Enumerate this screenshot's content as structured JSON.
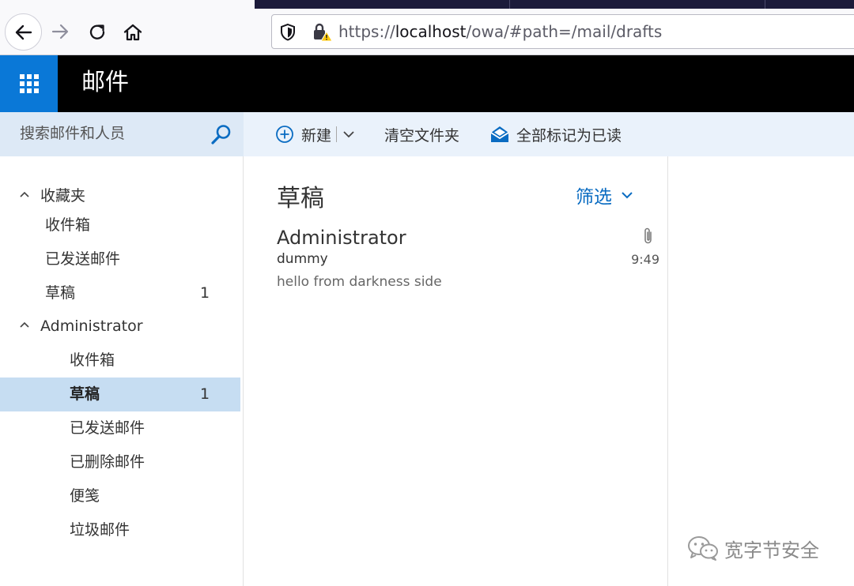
{
  "browser": {
    "url_prefix": "https://",
    "url_host": "localhost",
    "url_path": "/owa/#path=/mail/drafts"
  },
  "header": {
    "app_title": "邮件"
  },
  "search": {
    "placeholder": "搜索邮件和人员"
  },
  "toolbar": {
    "new_label": "新建",
    "empty_folder_label": "清空文件夹",
    "mark_all_read_label": "全部标记为已读"
  },
  "folders": {
    "favorites_header": "收藏夹",
    "favorites": [
      {
        "label": "收件箱",
        "count": ""
      },
      {
        "label": "已发送邮件",
        "count": ""
      },
      {
        "label": "草稿",
        "count": "1"
      }
    ],
    "account_header": "Administrator",
    "account": [
      {
        "label": "收件箱",
        "count": ""
      },
      {
        "label": "草稿",
        "count": "1",
        "selected": true
      },
      {
        "label": "已发送邮件",
        "count": ""
      },
      {
        "label": "已删除邮件",
        "count": ""
      },
      {
        "label": "便笺",
        "count": ""
      },
      {
        "label": "垃圾邮件",
        "count": ""
      }
    ]
  },
  "message_list": {
    "title": "草稿",
    "filter_label": "筛选",
    "items": [
      {
        "sender": "Administrator",
        "subject": "dummy",
        "time": "9:49",
        "preview": "hello from darkness side",
        "has_attachment": true
      }
    ]
  },
  "watermark": {
    "text": "宽字节安全"
  },
  "colors": {
    "accent": "#0a78d7",
    "header_bg": "#000000",
    "selected_folder_bg": "#c6ddf2",
    "toolbar_bg": "#eaf2fb",
    "search_bg": "#dde9f6",
    "link_blue": "#0a6cc2"
  },
  "icons": {
    "back": "back-arrow-icon",
    "forward": "forward-arrow-icon",
    "reload": "reload-icon",
    "home": "home-icon",
    "tracking": "shield-icon",
    "insecure": "insecure-lock-icon",
    "app_launcher": "waffle-icon",
    "search": "search-icon",
    "new": "plus-circle-icon",
    "mark_read": "open-envelope-icon",
    "attachment": "paperclip-icon",
    "watermark": "wechat-icon"
  }
}
